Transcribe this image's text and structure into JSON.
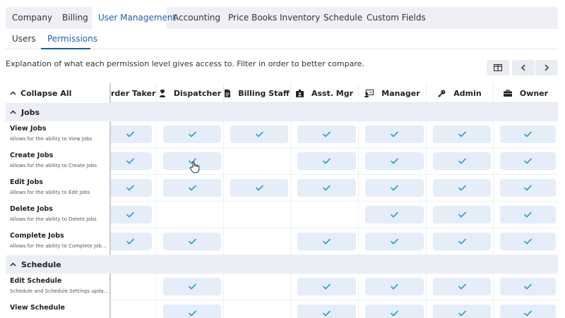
{
  "top_tabs": [
    {
      "label": "Company",
      "active": false
    },
    {
      "label": "Billing",
      "active": false
    },
    {
      "label": "User Management",
      "active": true
    },
    {
      "label": "Accounting",
      "active": false
    },
    {
      "label": "Price Books",
      "active": false
    },
    {
      "label": "Inventory",
      "active": false
    },
    {
      "label": "Schedule",
      "active": false
    },
    {
      "label": "Custom Fields",
      "active": false
    }
  ],
  "sub_tabs": [
    {
      "label": "Users",
      "active": false
    },
    {
      "label": "Permissions",
      "active": true
    }
  ],
  "description": "Explanation of what each permission level gives access to. Filter in order to better compare.",
  "toolbar": {
    "columns_icon": "columns-icon",
    "prev_icon": "chevron-left-icon",
    "next_icon": "chevron-right-icon"
  },
  "collapse_all_label": "Collapse All",
  "roles": [
    {
      "label": "rder Taker",
      "icon": "none"
    },
    {
      "label": "Dispatcher",
      "icon": "user-headset-icon"
    },
    {
      "label": "Billing Staff",
      "icon": "document-icon"
    },
    {
      "label": "Asst. Mgr",
      "icon": "id-badge-icon"
    },
    {
      "label": "Manager",
      "icon": "user-board-icon"
    },
    {
      "label": "Admin",
      "icon": "key-icon"
    },
    {
      "label": "Owner",
      "icon": "briefcase-icon"
    }
  ],
  "sections": [
    {
      "label": "Jobs",
      "rows": [
        {
          "title": "View Jobs",
          "subtitle": "Allows for the ability to View Jobs",
          "perms": [
            true,
            true,
            true,
            true,
            true,
            true,
            true
          ]
        },
        {
          "title": "Create Jobs",
          "subtitle": "Allows for the ability to Create Jobs",
          "perms": [
            true,
            true,
            false,
            true,
            true,
            true,
            true
          ]
        },
        {
          "title": "Edit Jobs",
          "subtitle": "Allows for the ability to Edit Jobs",
          "perms": [
            true,
            true,
            true,
            true,
            true,
            true,
            true
          ]
        },
        {
          "title": "Delete Jobs",
          "subtitle": "Allows for the ability to Delete Jobs",
          "perms": [
            true,
            false,
            false,
            false,
            true,
            true,
            true
          ]
        },
        {
          "title": "Complete Jobs",
          "subtitle": "Allows for the ability to Complete Jobs ...",
          "perms": [
            true,
            true,
            false,
            true,
            true,
            true,
            true
          ]
        }
      ]
    },
    {
      "label": "Schedule",
      "rows": [
        {
          "title": "Edit Schedule",
          "subtitle": "Schedule and Schedule Settings updates",
          "perms": [
            false,
            true,
            false,
            true,
            true,
            true,
            true
          ]
        },
        {
          "title": "View Schedule",
          "subtitle": "",
          "perms": [
            false,
            true,
            false,
            true,
            true,
            true,
            true
          ]
        }
      ]
    }
  ],
  "colors": {
    "accent": "#1a5fa8",
    "check": "#2a9fc9",
    "pill": "#e4edf8",
    "section_bg": "#eceef7"
  }
}
